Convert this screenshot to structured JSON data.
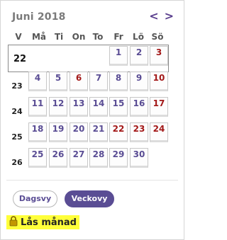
{
  "header": {
    "month_title": "Juni 2018",
    "prev_icon": "chevron-left-icon",
    "next_icon": "chevron-right-icon",
    "prev": "<",
    "next": ">"
  },
  "weekdays": [
    "V",
    "Må",
    "Ti",
    "On",
    "To",
    "Fr",
    "Lö",
    "Sö"
  ],
  "weeks": [
    {
      "week": "22",
      "days": [
        "",
        "",
        "",
        "",
        "1",
        "2",
        "3"
      ]
    },
    {
      "week": "23",
      "days": [
        "4",
        "5",
        "6",
        "7",
        "8",
        "9",
        "10"
      ]
    },
    {
      "week": "24",
      "days": [
        "11",
        "12",
        "13",
        "14",
        "15",
        "16",
        "17"
      ]
    },
    {
      "week": "25",
      "days": [
        "18",
        "19",
        "20",
        "21",
        "22",
        "23",
        "24"
      ]
    },
    {
      "week": "26",
      "days": [
        "25",
        "26",
        "27",
        "28",
        "29",
        "30",
        ""
      ]
    }
  ],
  "red_days": [
    "3",
    "6",
    "10",
    "17",
    "22",
    "23",
    "24"
  ],
  "view_buttons": {
    "day": "Dagsvy",
    "week": "Veckovy",
    "active": "week"
  },
  "lock": {
    "label": "Lås månad",
    "icon": "lock-icon"
  },
  "colors": {
    "accent": "#5a4d94",
    "holiday": "#a31919",
    "highlight": "#ffff3a"
  }
}
